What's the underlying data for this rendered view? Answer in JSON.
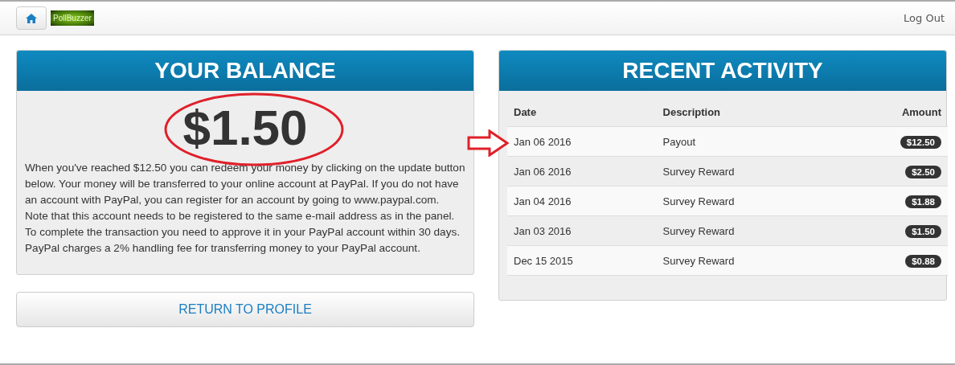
{
  "navbar": {
    "logo": "PollBuzzer",
    "logout": "Log Out"
  },
  "balance": {
    "title": "YOUR BALANCE",
    "amount": "$1.50",
    "paragraphs": [
      "When you've reached $12.50 you can redeem your money by clicking on the update button below. Your money will be transferred to your online account at PayPal. If you do not have an account with PayPal, you can register for an account by going to www.paypal.com.",
      "Note that this account needs to be registered to the same e-mail address as in the panel. To complete the transaction you need to approve it in your PayPal account within 30 days. PayPal charges a 2% handling fee for transferring money to your PayPal account."
    ],
    "button": "RETURN TO PROFILE"
  },
  "activity": {
    "title": "RECENT ACTIVITY",
    "columns": [
      "Date",
      "Description",
      "Amount"
    ],
    "rows": [
      {
        "date": "Jan 06 2016",
        "description": "Payout",
        "amount": "$12.50"
      },
      {
        "date": "Jan 06 2016",
        "description": "Survey Reward",
        "amount": "$2.50"
      },
      {
        "date": "Jan 04 2016",
        "description": "Survey Reward",
        "amount": "$1.88"
      },
      {
        "date": "Jan 03 2016",
        "description": "Survey Reward",
        "amount": "$1.50"
      },
      {
        "date": "Dec 15 2015",
        "description": "Survey Reward",
        "amount": "$0.88"
      }
    ]
  }
}
